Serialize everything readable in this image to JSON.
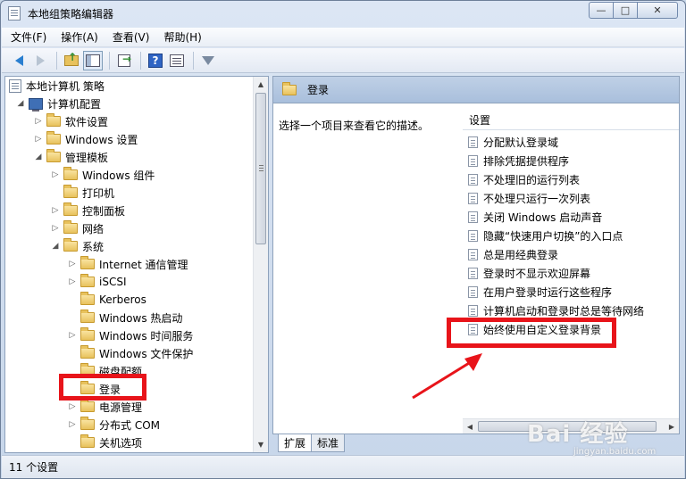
{
  "window": {
    "title": "本地组策略编辑器",
    "controls": {
      "minimize": "—",
      "maximize": "□",
      "close": "✕"
    }
  },
  "menu": [
    "文件(F)",
    "操作(A)",
    "查看(V)",
    "帮助(H)"
  ],
  "toolbar_icons": [
    "back-arrow-icon",
    "forward-arrow-icon",
    "folder-up-icon",
    "show-hide-tree-icon",
    "export-list-icon",
    "help-icon",
    "properties-icon",
    "filter-icon"
  ],
  "tree": {
    "root": "本地计算机 策略",
    "computer_config": "计算机配置",
    "software_settings": "软件设置",
    "windows_settings": "Windows 设置",
    "admin_templates": "管理模板",
    "windows_components": "Windows 组件",
    "printers": "打印机",
    "control_panel": "控制面板",
    "network": "网络",
    "system": "系统",
    "internet_comm": "Internet 通信管理",
    "iscsi": "iSCSI",
    "kerberos": "Kerberos",
    "windows_hotstart": "Windows 热启动",
    "windows_time": "Windows 时间服务",
    "windows_file_protection": "Windows 文件保护",
    "disk_quota": "磁盘配额",
    "logon": "登录",
    "power_management": "电源管理",
    "distributed_com": "分布式 COM",
    "shutdown_options": "关机选项"
  },
  "right_pane": {
    "header": "登录",
    "description": "选择一个项目来查看它的描述。",
    "column_header": "设置",
    "settings": [
      "分配默认登录域",
      "排除凭据提供程序",
      "不处理旧的运行列表",
      "不处理只运行一次列表",
      "关闭 Windows 启动声音",
      "隐藏“快速用户切换”的入口点",
      "总是用经典登录",
      "登录时不显示欢迎屏幕",
      "在用户登录时运行这些程序",
      "计算机启动和登录时总是等待网络",
      "始终使用自定义登录背景"
    ]
  },
  "tabs": [
    "扩展",
    "标准"
  ],
  "status": "11 个设置",
  "watermark": {
    "main": "Bai 经验",
    "sub": "jingyan.baidu.com"
  },
  "annotation_color": "#e8141a"
}
